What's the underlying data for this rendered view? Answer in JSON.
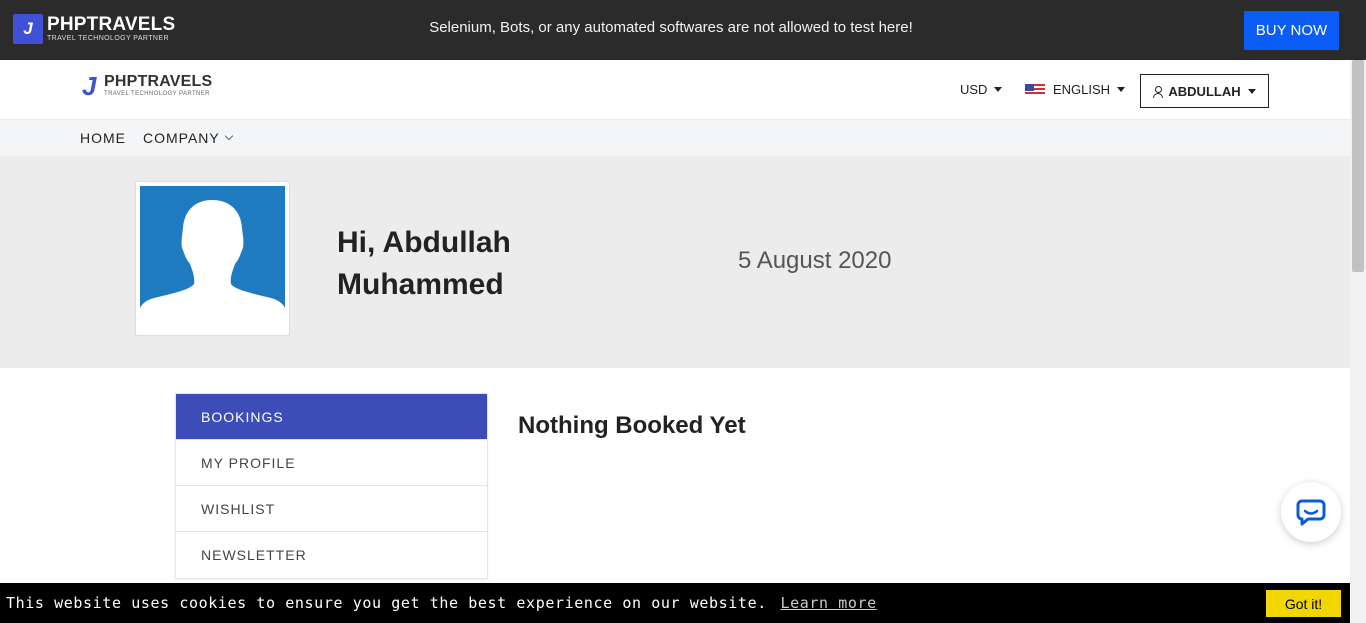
{
  "topbar": {
    "logo": {
      "name": "PHPTRAVELS",
      "tagline": "TRAVEL TECHNOLOGY PARTNER",
      "icon": "phptravels-logo-icon"
    },
    "notice": "Selenium, Bots, or any automated softwares are not allowed to test here!",
    "buy_now_label": "BUY NOW"
  },
  "header": {
    "logo": {
      "name": "PHPTRAVELS",
      "tagline": "TRAVEL TECHNOLOGY PARTNER"
    },
    "currency": "USD",
    "language": "ENGLISH",
    "language_flag": "us-flag-icon",
    "user": "ABDULLAH"
  },
  "nav": {
    "items": [
      {
        "label": "HOME"
      },
      {
        "label": "COMPANY"
      }
    ]
  },
  "profile": {
    "greeting": "Hi, Abdullah",
    "name_line": "Muhammed",
    "date": "5 August 2020",
    "avatar_color": "#1f7bc0"
  },
  "sidebar": {
    "items": [
      {
        "label": "BOOKINGS",
        "active": true
      },
      {
        "label": "MY PROFILE"
      },
      {
        "label": "WISHLIST"
      },
      {
        "label": "NEWSLETTER"
      }
    ]
  },
  "main": {
    "empty_message": "Nothing Booked Yet"
  },
  "chat": {
    "icon": "chat-bubble-icon"
  },
  "cookie": {
    "message": "This website uses cookies to ensure you get the best experience on our website.",
    "link": "Learn more",
    "button": "Got it!"
  },
  "colors": {
    "brand": "#3f51d5",
    "buy_now": "#0b5cf4",
    "active_tab": "#3d4db7",
    "cookie_button": "#f1d600"
  }
}
